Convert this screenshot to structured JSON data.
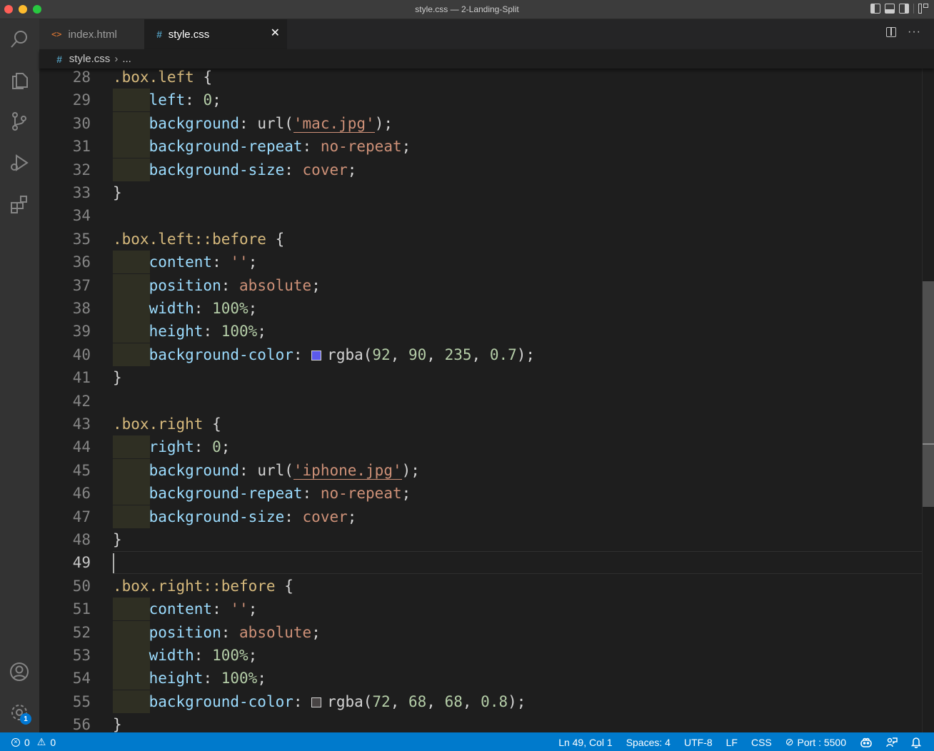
{
  "window": {
    "title": "style.css — 2-Landing-Split"
  },
  "tabs": [
    {
      "label": "index.html",
      "icon": "html-file-icon",
      "active": false
    },
    {
      "label": "style.css",
      "icon": "css-file-icon",
      "active": true
    }
  ],
  "breadcrumb": {
    "file": "style.css",
    "more": "..."
  },
  "editor": {
    "active_line": 49,
    "lines": [
      {
        "n": "28",
        "text": ".box.left {"
      },
      {
        "n": "29",
        "text": "left: 0;"
      },
      {
        "n": "30",
        "text": "background: url('mac.jpg');"
      },
      {
        "n": "31",
        "text": "background-repeat: no-repeat;"
      },
      {
        "n": "32",
        "text": "background-size: cover;"
      },
      {
        "n": "33",
        "text": "}"
      },
      {
        "n": "34",
        "text": ""
      },
      {
        "n": "35",
        "text": ".box.left::before {"
      },
      {
        "n": "36",
        "text": "content: '';"
      },
      {
        "n": "37",
        "text": "position: absolute;"
      },
      {
        "n": "38",
        "text": "width: 100%;"
      },
      {
        "n": "39",
        "text": "height: 100%;"
      },
      {
        "n": "40",
        "text": "background-color: rgba(92, 90, 235, 0.7);",
        "swatch": "#5c5aeb"
      },
      {
        "n": "41",
        "text": "}"
      },
      {
        "n": "42",
        "text": ""
      },
      {
        "n": "43",
        "text": ".box.right {"
      },
      {
        "n": "44",
        "text": "right: 0;"
      },
      {
        "n": "45",
        "text": "background: url('iphone.jpg');"
      },
      {
        "n": "46",
        "text": "background-repeat: no-repeat;"
      },
      {
        "n": "47",
        "text": "background-size: cover;"
      },
      {
        "n": "48",
        "text": "}"
      },
      {
        "n": "49",
        "text": ""
      },
      {
        "n": "50",
        "text": ".box.right::before {"
      },
      {
        "n": "51",
        "text": "content: '';"
      },
      {
        "n": "52",
        "text": "position: absolute;"
      },
      {
        "n": "53",
        "text": "width: 100%;"
      },
      {
        "n": "54",
        "text": "height: 100%;"
      },
      {
        "n": "55",
        "text": "background-color: rgba(72, 68, 68, 0.8);",
        "swatch": "#484444"
      },
      {
        "n": "56",
        "text": "}"
      }
    ]
  },
  "activity_bar": {
    "items": [
      "search-icon",
      "explorer-icon",
      "source-control-icon",
      "run-debug-icon",
      "extensions-icon"
    ],
    "bottom": [
      "accounts-icon",
      "manage-gear-icon"
    ],
    "settings_badge": "1"
  },
  "statusbar": {
    "errors": "0",
    "warnings": "0",
    "position": "Ln 49, Col 1",
    "spaces": "Spaces: 4",
    "encoding": "UTF-8",
    "eol": "LF",
    "language": "CSS",
    "port": "Port : 5500"
  },
  "colors": {
    "accent": "#007acc",
    "selector": "#d7ba7d",
    "property": "#9cdcfe",
    "value": "#ce9178",
    "number": "#b5cea8",
    "function": "#dcdcaa"
  }
}
